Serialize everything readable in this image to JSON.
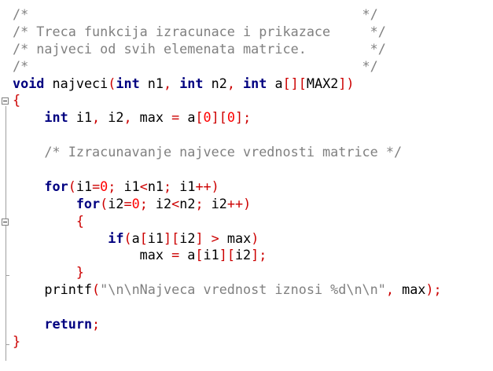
{
  "editor": {
    "language": "C",
    "colors": {
      "comment": "#808080",
      "keyword": "#000080",
      "number": "#ff0000",
      "operator": "#cc0000",
      "string": "#808080",
      "text": "#000000"
    },
    "lines": [
      [
        {
          "t": "/*                                          */",
          "c": "c-comment"
        }
      ],
      [
        {
          "t": "/* Treca funkcija izracunace i prikazace     */",
          "c": "c-comment"
        }
      ],
      [
        {
          "t": "/* najveci od svih elemenata matrice.        */",
          "c": "c-comment"
        }
      ],
      [
        {
          "t": "/*                                          */",
          "c": "c-comment"
        }
      ],
      [
        {
          "t": "void",
          "c": "c-keyword"
        },
        {
          "t": " najveci",
          "c": "c-plain"
        },
        {
          "t": "(",
          "c": "c-op"
        },
        {
          "t": "int",
          "c": "c-keyword"
        },
        {
          "t": " n1",
          "c": "c-plain"
        },
        {
          "t": ",",
          "c": "c-op"
        },
        {
          "t": " ",
          "c": "c-plain"
        },
        {
          "t": "int",
          "c": "c-keyword"
        },
        {
          "t": " n2",
          "c": "c-plain"
        },
        {
          "t": ",",
          "c": "c-op"
        },
        {
          "t": " ",
          "c": "c-plain"
        },
        {
          "t": "int",
          "c": "c-keyword"
        },
        {
          "t": " a",
          "c": "c-plain"
        },
        {
          "t": "[][",
          "c": "c-op"
        },
        {
          "t": "MAX2",
          "c": "c-plain"
        },
        {
          "t": "])",
          "c": "c-op"
        }
      ],
      [
        {
          "t": "{",
          "c": "c-op"
        }
      ],
      [
        {
          "t": "    ",
          "c": "c-plain"
        },
        {
          "t": "int",
          "c": "c-keyword"
        },
        {
          "t": " i1",
          "c": "c-plain"
        },
        {
          "t": ",",
          "c": "c-op"
        },
        {
          "t": " i2",
          "c": "c-plain"
        },
        {
          "t": ",",
          "c": "c-op"
        },
        {
          "t": " max ",
          "c": "c-plain"
        },
        {
          "t": "=",
          "c": "c-op"
        },
        {
          "t": " a",
          "c": "c-plain"
        },
        {
          "t": "[",
          "c": "c-op"
        },
        {
          "t": "0",
          "c": "c-number"
        },
        {
          "t": "][",
          "c": "c-op"
        },
        {
          "t": "0",
          "c": "c-number"
        },
        {
          "t": "];",
          "c": "c-op"
        }
      ],
      [],
      [
        {
          "t": "    ",
          "c": "c-plain"
        },
        {
          "t": "/* Izracunavanje najvece vrednosti matrice */",
          "c": "c-comment"
        }
      ],
      [],
      [
        {
          "t": "    ",
          "c": "c-plain"
        },
        {
          "t": "for",
          "c": "c-keyword"
        },
        {
          "t": "(",
          "c": "c-op"
        },
        {
          "t": "i1",
          "c": "c-plain"
        },
        {
          "t": "=",
          "c": "c-op"
        },
        {
          "t": "0",
          "c": "c-number"
        },
        {
          "t": ";",
          "c": "c-op"
        },
        {
          "t": " i1",
          "c": "c-plain"
        },
        {
          "t": "<",
          "c": "c-op"
        },
        {
          "t": "n1",
          "c": "c-plain"
        },
        {
          "t": ";",
          "c": "c-op"
        },
        {
          "t": " i1",
          "c": "c-plain"
        },
        {
          "t": "++)",
          "c": "c-op"
        }
      ],
      [
        {
          "t": "        ",
          "c": "c-plain"
        },
        {
          "t": "for",
          "c": "c-keyword"
        },
        {
          "t": "(",
          "c": "c-op"
        },
        {
          "t": "i2",
          "c": "c-plain"
        },
        {
          "t": "=",
          "c": "c-op"
        },
        {
          "t": "0",
          "c": "c-number"
        },
        {
          "t": ";",
          "c": "c-op"
        },
        {
          "t": " i2",
          "c": "c-plain"
        },
        {
          "t": "<",
          "c": "c-op"
        },
        {
          "t": "n2",
          "c": "c-plain"
        },
        {
          "t": ";",
          "c": "c-op"
        },
        {
          "t": " i2",
          "c": "c-plain"
        },
        {
          "t": "++)",
          "c": "c-op"
        }
      ],
      [
        {
          "t": "        ",
          "c": "c-plain"
        },
        {
          "t": "{",
          "c": "c-op"
        }
      ],
      [
        {
          "t": "            ",
          "c": "c-plain"
        },
        {
          "t": "if",
          "c": "c-keyword"
        },
        {
          "t": "(",
          "c": "c-op"
        },
        {
          "t": "a",
          "c": "c-plain"
        },
        {
          "t": "[",
          "c": "c-op"
        },
        {
          "t": "i1",
          "c": "c-plain"
        },
        {
          "t": "][",
          "c": "c-op"
        },
        {
          "t": "i2",
          "c": "c-plain"
        },
        {
          "t": "]",
          "c": "c-op"
        },
        {
          "t": " ",
          "c": "c-plain"
        },
        {
          "t": ">",
          "c": "c-op"
        },
        {
          "t": " max",
          "c": "c-plain"
        },
        {
          "t": ")",
          "c": "c-op"
        }
      ],
      [
        {
          "t": "                max ",
          "c": "c-plain"
        },
        {
          "t": "=",
          "c": "c-op"
        },
        {
          "t": " a",
          "c": "c-plain"
        },
        {
          "t": "[",
          "c": "c-op"
        },
        {
          "t": "i1",
          "c": "c-plain"
        },
        {
          "t": "][",
          "c": "c-op"
        },
        {
          "t": "i2",
          "c": "c-plain"
        },
        {
          "t": "];",
          "c": "c-op"
        }
      ],
      [
        {
          "t": "        ",
          "c": "c-plain"
        },
        {
          "t": "}",
          "c": "c-op"
        }
      ],
      [
        {
          "t": "    printf",
          "c": "c-plain"
        },
        {
          "t": "(",
          "c": "c-op"
        },
        {
          "t": "\"\\n\\nNajveca vrednost iznosi %d\\n\\n\"",
          "c": "c-string"
        },
        {
          "t": ",",
          "c": "c-op"
        },
        {
          "t": " max",
          "c": "c-plain"
        },
        {
          "t": ");",
          "c": "c-op"
        }
      ],
      [],
      [
        {
          "t": "    ",
          "c": "c-plain"
        },
        {
          "t": "return",
          "c": "c-keyword"
        },
        {
          "t": ";",
          "c": "c-op"
        }
      ],
      [
        {
          "t": "}",
          "c": "c-op"
        }
      ]
    ]
  }
}
